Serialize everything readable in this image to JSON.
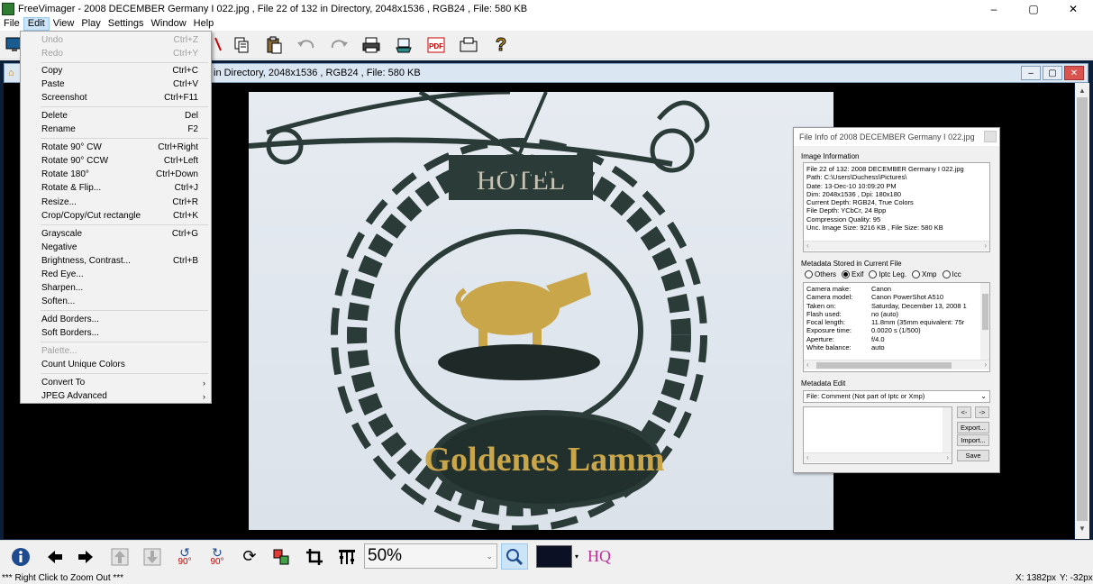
{
  "window": {
    "title": "FreeVimager - 2008 DECEMBER Germany I 022.jpg , File 22 of 132 in Directory, 2048x1536 , RGB24 , File: 580 KB",
    "controls": {
      "minimize": "–",
      "maximize": "▢",
      "close": "✕"
    }
  },
  "menubar": [
    "File",
    "Edit",
    "View",
    "Play",
    "Settings",
    "Window",
    "Help"
  ],
  "child_window": {
    "title": "in Directory, 2048x1536 , RGB24 , File: 580 KB"
  },
  "edit_menu": [
    {
      "label": "Undo",
      "shortcut": "Ctrl+Z",
      "disabled": true
    },
    {
      "label": "Redo",
      "shortcut": "Ctrl+Y",
      "disabled": true
    },
    {
      "separator": true
    },
    {
      "label": "Copy",
      "shortcut": "Ctrl+C"
    },
    {
      "label": "Paste",
      "shortcut": "Ctrl+V"
    },
    {
      "label": "Screenshot",
      "shortcut": "Ctrl+F11"
    },
    {
      "separator": true
    },
    {
      "label": "Delete",
      "shortcut": "Del"
    },
    {
      "label": "Rename",
      "shortcut": "F2"
    },
    {
      "separator": true
    },
    {
      "label": "Rotate 90° CW",
      "shortcut": "Ctrl+Right"
    },
    {
      "label": "Rotate 90° CCW",
      "shortcut": "Ctrl+Left"
    },
    {
      "label": "Rotate 180°",
      "shortcut": "Ctrl+Down"
    },
    {
      "label": "Rotate & Flip...",
      "shortcut": "Ctrl+J"
    },
    {
      "label": "Resize...",
      "shortcut": "Ctrl+R"
    },
    {
      "label": "Crop/Copy/Cut rectangle",
      "shortcut": "Ctrl+K"
    },
    {
      "separator": true
    },
    {
      "label": "Grayscale",
      "shortcut": "Ctrl+G"
    },
    {
      "label": "Negative",
      "shortcut": ""
    },
    {
      "label": "Brightness, Contrast...",
      "shortcut": "Ctrl+B"
    },
    {
      "label": "Red Eye...",
      "shortcut": ""
    },
    {
      "label": "Sharpen...",
      "shortcut": ""
    },
    {
      "label": "Soften...",
      "shortcut": ""
    },
    {
      "separator": true
    },
    {
      "label": "Add Borders...",
      "shortcut": ""
    },
    {
      "label": "Soft Borders...",
      "shortcut": ""
    },
    {
      "separator": true
    },
    {
      "label": "Palette...",
      "shortcut": "",
      "disabled": true
    },
    {
      "label": "Count Unique Colors",
      "shortcut": ""
    },
    {
      "separator": true
    },
    {
      "label": "Convert To",
      "shortcut": "",
      "submenu": true
    },
    {
      "label": "JPEG Advanced",
      "shortcut": "",
      "submenu": true
    }
  ],
  "photo": {
    "hotel_text": "HOTEL",
    "sign_text": "Goldenes Lamm"
  },
  "file_info": {
    "title": "File Info of 2008 DECEMBER Germany I 022.jpg",
    "image_info_title": "Image Information",
    "image_info_lines": [
      "File 22 of 132: 2008 DECEMBER Germany I 022.jpg",
      "Path: C:\\Users\\Duchess\\Pictures\\",
      "Date: 13-Dec-10 10:09:20 PM",
      "Dim: 2048x1536 , Dpi: 180x180",
      "Current Depth: RGB24, True Colors",
      "File Depth: YCbCr, 24 Bpp",
      "Compression Quality: 95",
      "Unc. Image Size: 9216 KB , File Size: 580 KB"
    ],
    "metadata_title": "Metadata Stored in Current File",
    "metadata_options": [
      {
        "label": "Others",
        "checked": false
      },
      {
        "label": "Exif",
        "checked": true
      },
      {
        "label": "Iptc Leg.",
        "checked": false
      },
      {
        "label": "Xmp",
        "checked": false
      },
      {
        "label": "Icc",
        "checked": false
      }
    ],
    "metadata_rows": [
      {
        "key": "Camera make:",
        "value": "Canon"
      },
      {
        "key": "Camera model:",
        "value": "Canon PowerShot A510"
      },
      {
        "key": "Taken on:",
        "value": "Saturday, December 13, 2008 1"
      },
      {
        "key": "Flash used:",
        "value": "no (auto)"
      },
      {
        "key": "Focal length:",
        "value": "11.8mm (35mm equivalent: 75r"
      },
      {
        "key": "Exposure time:",
        "value": "0.0020 s (1/500)"
      },
      {
        "key": "Aperture:",
        "value": "f/4.0"
      },
      {
        "key": "White balance:",
        "value": "auto"
      }
    ],
    "metadata_edit_title": "Metadata Edit",
    "metadata_edit_select": "File: Comment (Not part of Iptc or Xmp)",
    "buttons": {
      "prev": "<-",
      "next": "->",
      "export": "Export...",
      "import": "Import...",
      "save": "Save"
    }
  },
  "bottom_toolbar": {
    "zoom_value": "50%",
    "rotate_cw_label": "90°",
    "rotate_ccw_label": "90°",
    "hq_label": "HQ",
    "swatch_color": "#0b1024"
  },
  "status": {
    "left": "*** Right Click to Zoom Out ***",
    "x": "X: 1382px",
    "y": "Y: -32px"
  },
  "colors": {
    "accent": "#cce4f7",
    "mdi_background": "#0b1f3a",
    "sign_iron": "#2a3b38",
    "gold": "#c9a64a"
  }
}
